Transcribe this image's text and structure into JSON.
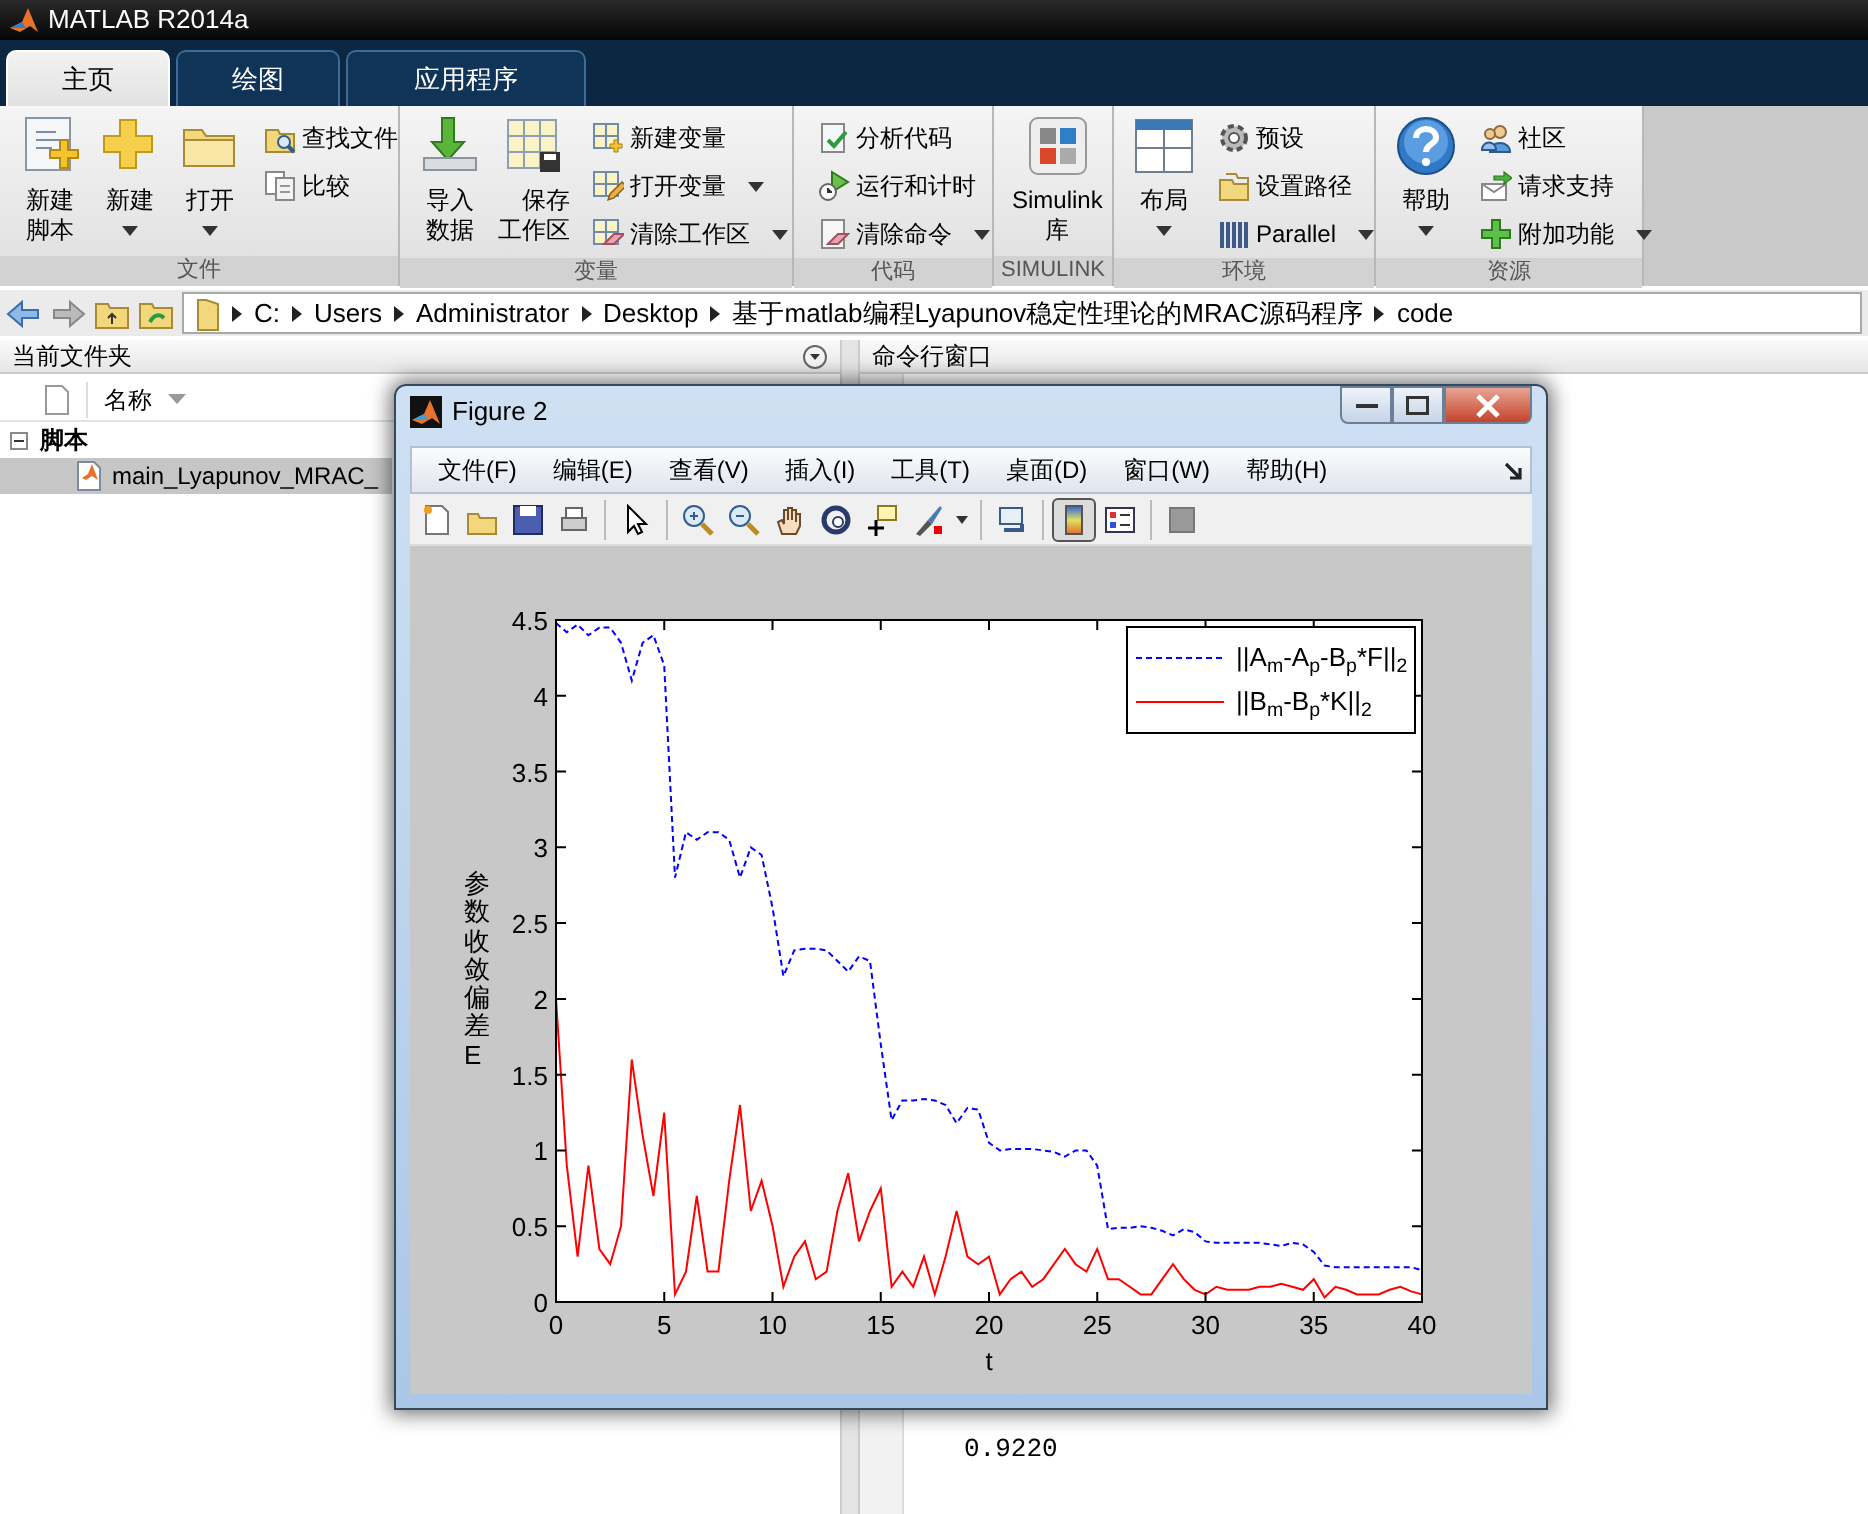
{
  "app": {
    "title": "MATLAB R2014a"
  },
  "tabs": [
    {
      "label": "主页",
      "selected": true
    },
    {
      "label": "绘图",
      "selected": false
    },
    {
      "label": "应用程序",
      "selected": false
    }
  ],
  "ribbon_groups": [
    {
      "label": "文件",
      "items": [
        {
          "kind": "large",
          "label": "新建脚本",
          "dropdown": false
        },
        {
          "kind": "large",
          "label": "新建",
          "dropdown": true
        },
        {
          "kind": "large",
          "label": "打开",
          "dropdown": true
        },
        {
          "kind": "small",
          "label": "查找文件",
          "dropdown": false
        },
        {
          "kind": "small",
          "label": "比较",
          "dropdown": false
        }
      ]
    },
    {
      "label": "变量",
      "items": [
        {
          "kind": "large",
          "label": "导入数据",
          "dropdown": false
        },
        {
          "kind": "large",
          "label": "保存工作区",
          "dropdown": false
        },
        {
          "kind": "small",
          "label": "新建变量",
          "dropdown": false
        },
        {
          "kind": "small",
          "label": "打开变量",
          "dropdown": true
        },
        {
          "kind": "small",
          "label": "清除工作区",
          "dropdown": true
        }
      ]
    },
    {
      "label": "代码",
      "items": [
        {
          "kind": "small",
          "label": "分析代码",
          "dropdown": false
        },
        {
          "kind": "small",
          "label": "运行和计时",
          "dropdown": false
        },
        {
          "kind": "small",
          "label": "清除命令",
          "dropdown": true
        }
      ]
    },
    {
      "label": "SIMULINK",
      "items": [
        {
          "kind": "large",
          "label": "Simulink库",
          "dropdown": false
        }
      ]
    },
    {
      "label": "环境",
      "items": [
        {
          "kind": "large",
          "label": "布局",
          "dropdown": true
        },
        {
          "kind": "small",
          "label": "预设",
          "dropdown": false
        },
        {
          "kind": "small",
          "label": "设置路径",
          "dropdown": false
        },
        {
          "kind": "small",
          "label": "Parallel",
          "dropdown": true
        }
      ]
    },
    {
      "label": "资源",
      "items": [
        {
          "kind": "large",
          "label": "帮助",
          "dropdown": true
        },
        {
          "kind": "small",
          "label": "社区",
          "dropdown": false
        },
        {
          "kind": "small",
          "label": "请求支持",
          "dropdown": false
        },
        {
          "kind": "small",
          "label": "附加功能",
          "dropdown": true
        }
      ]
    }
  ],
  "address_bar": {
    "path": [
      "C:",
      "Users",
      "Administrator",
      "Desktop",
      "基于matlab编程Lyapunov稳定性理论的MRAC源码程序",
      "code"
    ]
  },
  "current_folder": {
    "title": "当前文件夹",
    "column": "名称",
    "tree": [
      {
        "label": "脚本",
        "expanded": true,
        "children": [
          {
            "label": "main_Lyapunov_MRAC_",
            "selected": true
          }
        ]
      }
    ]
  },
  "command_window": {
    "title": "命令行窗口",
    "output": "0.9220"
  },
  "figure": {
    "title": "Figure 2",
    "menus": [
      "文件(F)",
      "编辑(E)",
      "查看(V)",
      "插入(I)",
      "工具(T)",
      "桌面(D)",
      "窗口(W)",
      "帮助(H)"
    ],
    "toolbar": [
      {
        "pressed": false
      },
      {
        "pressed": false
      },
      {
        "pressed": false
      },
      {
        "pressed": false
      },
      {
        "pressed": false
      },
      {
        "pressed": false
      },
      {
        "pressed": false
      },
      {
        "pressed": false
      },
      {
        "pressed": false
      },
      {
        "pressed": false
      },
      {
        "pressed": false
      },
      {
        "pressed": false
      },
      {
        "pressed": false
      },
      {
        "pressed": true
      },
      {
        "pressed": false
      },
      {
        "pressed": false
      }
    ],
    "chart_data": {
      "type": "line",
      "xlabel": "t",
      "ylabel": "参数收敛偏差E",
      "xlim": [
        0,
        40
      ],
      "ylim": [
        0,
        4.5
      ],
      "xticks": [
        0,
        5,
        10,
        15,
        20,
        25,
        30,
        35,
        40
      ],
      "yticks": [
        0,
        0.5,
        1,
        1.5,
        2,
        2.5,
        3,
        3.5,
        4,
        4.5
      ],
      "legend": true,
      "x": [
        0,
        0.5,
        1,
        1.5,
        2,
        2.5,
        3,
        3.5,
        4,
        4.5,
        5,
        5.5,
        6,
        6.5,
        7,
        7.5,
        8,
        8.5,
        9,
        9.5,
        10,
        10.5,
        11,
        11.5,
        12,
        12.5,
        13,
        13.5,
        14,
        14.5,
        15,
        15.5,
        16,
        16.5,
        17,
        17.5,
        18,
        18.5,
        19,
        19.5,
        20,
        20.5,
        21,
        21.5,
        22,
        22.5,
        23,
        23.5,
        24,
        24.5,
        25,
        25.5,
        26,
        26.5,
        27,
        27.5,
        28,
        28.5,
        29,
        29.5,
        30,
        30.5,
        31,
        31.5,
        32,
        32.5,
        33,
        33.5,
        34,
        34.5,
        35,
        35.5,
        36,
        36.5,
        37,
        37.5,
        38,
        38.5,
        39,
        39.5,
        40
      ],
      "series": [
        {
          "name": "||A$_{m}$-A$_{p}$-B$_{p}$*F||$_{2}$",
          "color": "#0000ff",
          "line_style": "dashed",
          "values": [
            4.48,
            4.42,
            4.47,
            4.4,
            4.45,
            4.45,
            4.35,
            4.1,
            4.35,
            4.4,
            4.2,
            2.8,
            3.1,
            3.05,
            3.1,
            3.1,
            3.05,
            2.8,
            3.0,
            2.95,
            2.6,
            2.15,
            2.32,
            2.33,
            2.33,
            2.32,
            2.25,
            2.18,
            2.28,
            2.25,
            1.7,
            1.2,
            1.33,
            1.33,
            1.34,
            1.33,
            1.3,
            1.18,
            1.28,
            1.27,
            1.05,
            1.0,
            1.01,
            1.01,
            1.01,
            1.0,
            0.99,
            0.96,
            1.0,
            1.0,
            0.9,
            0.48,
            0.49,
            0.49,
            0.5,
            0.49,
            0.47,
            0.44,
            0.48,
            0.46,
            0.4,
            0.39,
            0.39,
            0.39,
            0.39,
            0.39,
            0.38,
            0.37,
            0.39,
            0.38,
            0.33,
            0.24,
            0.23,
            0.23,
            0.23,
            0.23,
            0.23,
            0.23,
            0.23,
            0.23,
            0.21
          ]
        },
        {
          "name": "||B$_{m}$-B$_{p}$*K||$_{2}$",
          "color": "#ff0000",
          "line_style": "solid",
          "values": [
            2.0,
            0.9,
            0.3,
            0.9,
            0.35,
            0.25,
            0.5,
            1.6,
            1.1,
            0.7,
            1.25,
            0.05,
            0.2,
            0.7,
            0.2,
            0.2,
            0.8,
            1.3,
            0.6,
            0.8,
            0.5,
            0.1,
            0.3,
            0.4,
            0.15,
            0.2,
            0.6,
            0.85,
            0.4,
            0.6,
            0.75,
            0.1,
            0.2,
            0.1,
            0.3,
            0.05,
            0.3,
            0.6,
            0.3,
            0.25,
            0.3,
            0.05,
            0.15,
            0.2,
            0.1,
            0.15,
            0.25,
            0.35,
            0.25,
            0.2,
            0.35,
            0.15,
            0.15,
            0.1,
            0.05,
            0.05,
            0.15,
            0.25,
            0.15,
            0.08,
            0.05,
            0.1,
            0.08,
            0.08,
            0.08,
            0.1,
            0.1,
            0.12,
            0.1,
            0.08,
            0.15,
            0.03,
            0.1,
            0.08,
            0.05,
            0.05,
            0.05,
            0.08,
            0.1,
            0.07,
            0.05
          ]
        }
      ]
    }
  }
}
